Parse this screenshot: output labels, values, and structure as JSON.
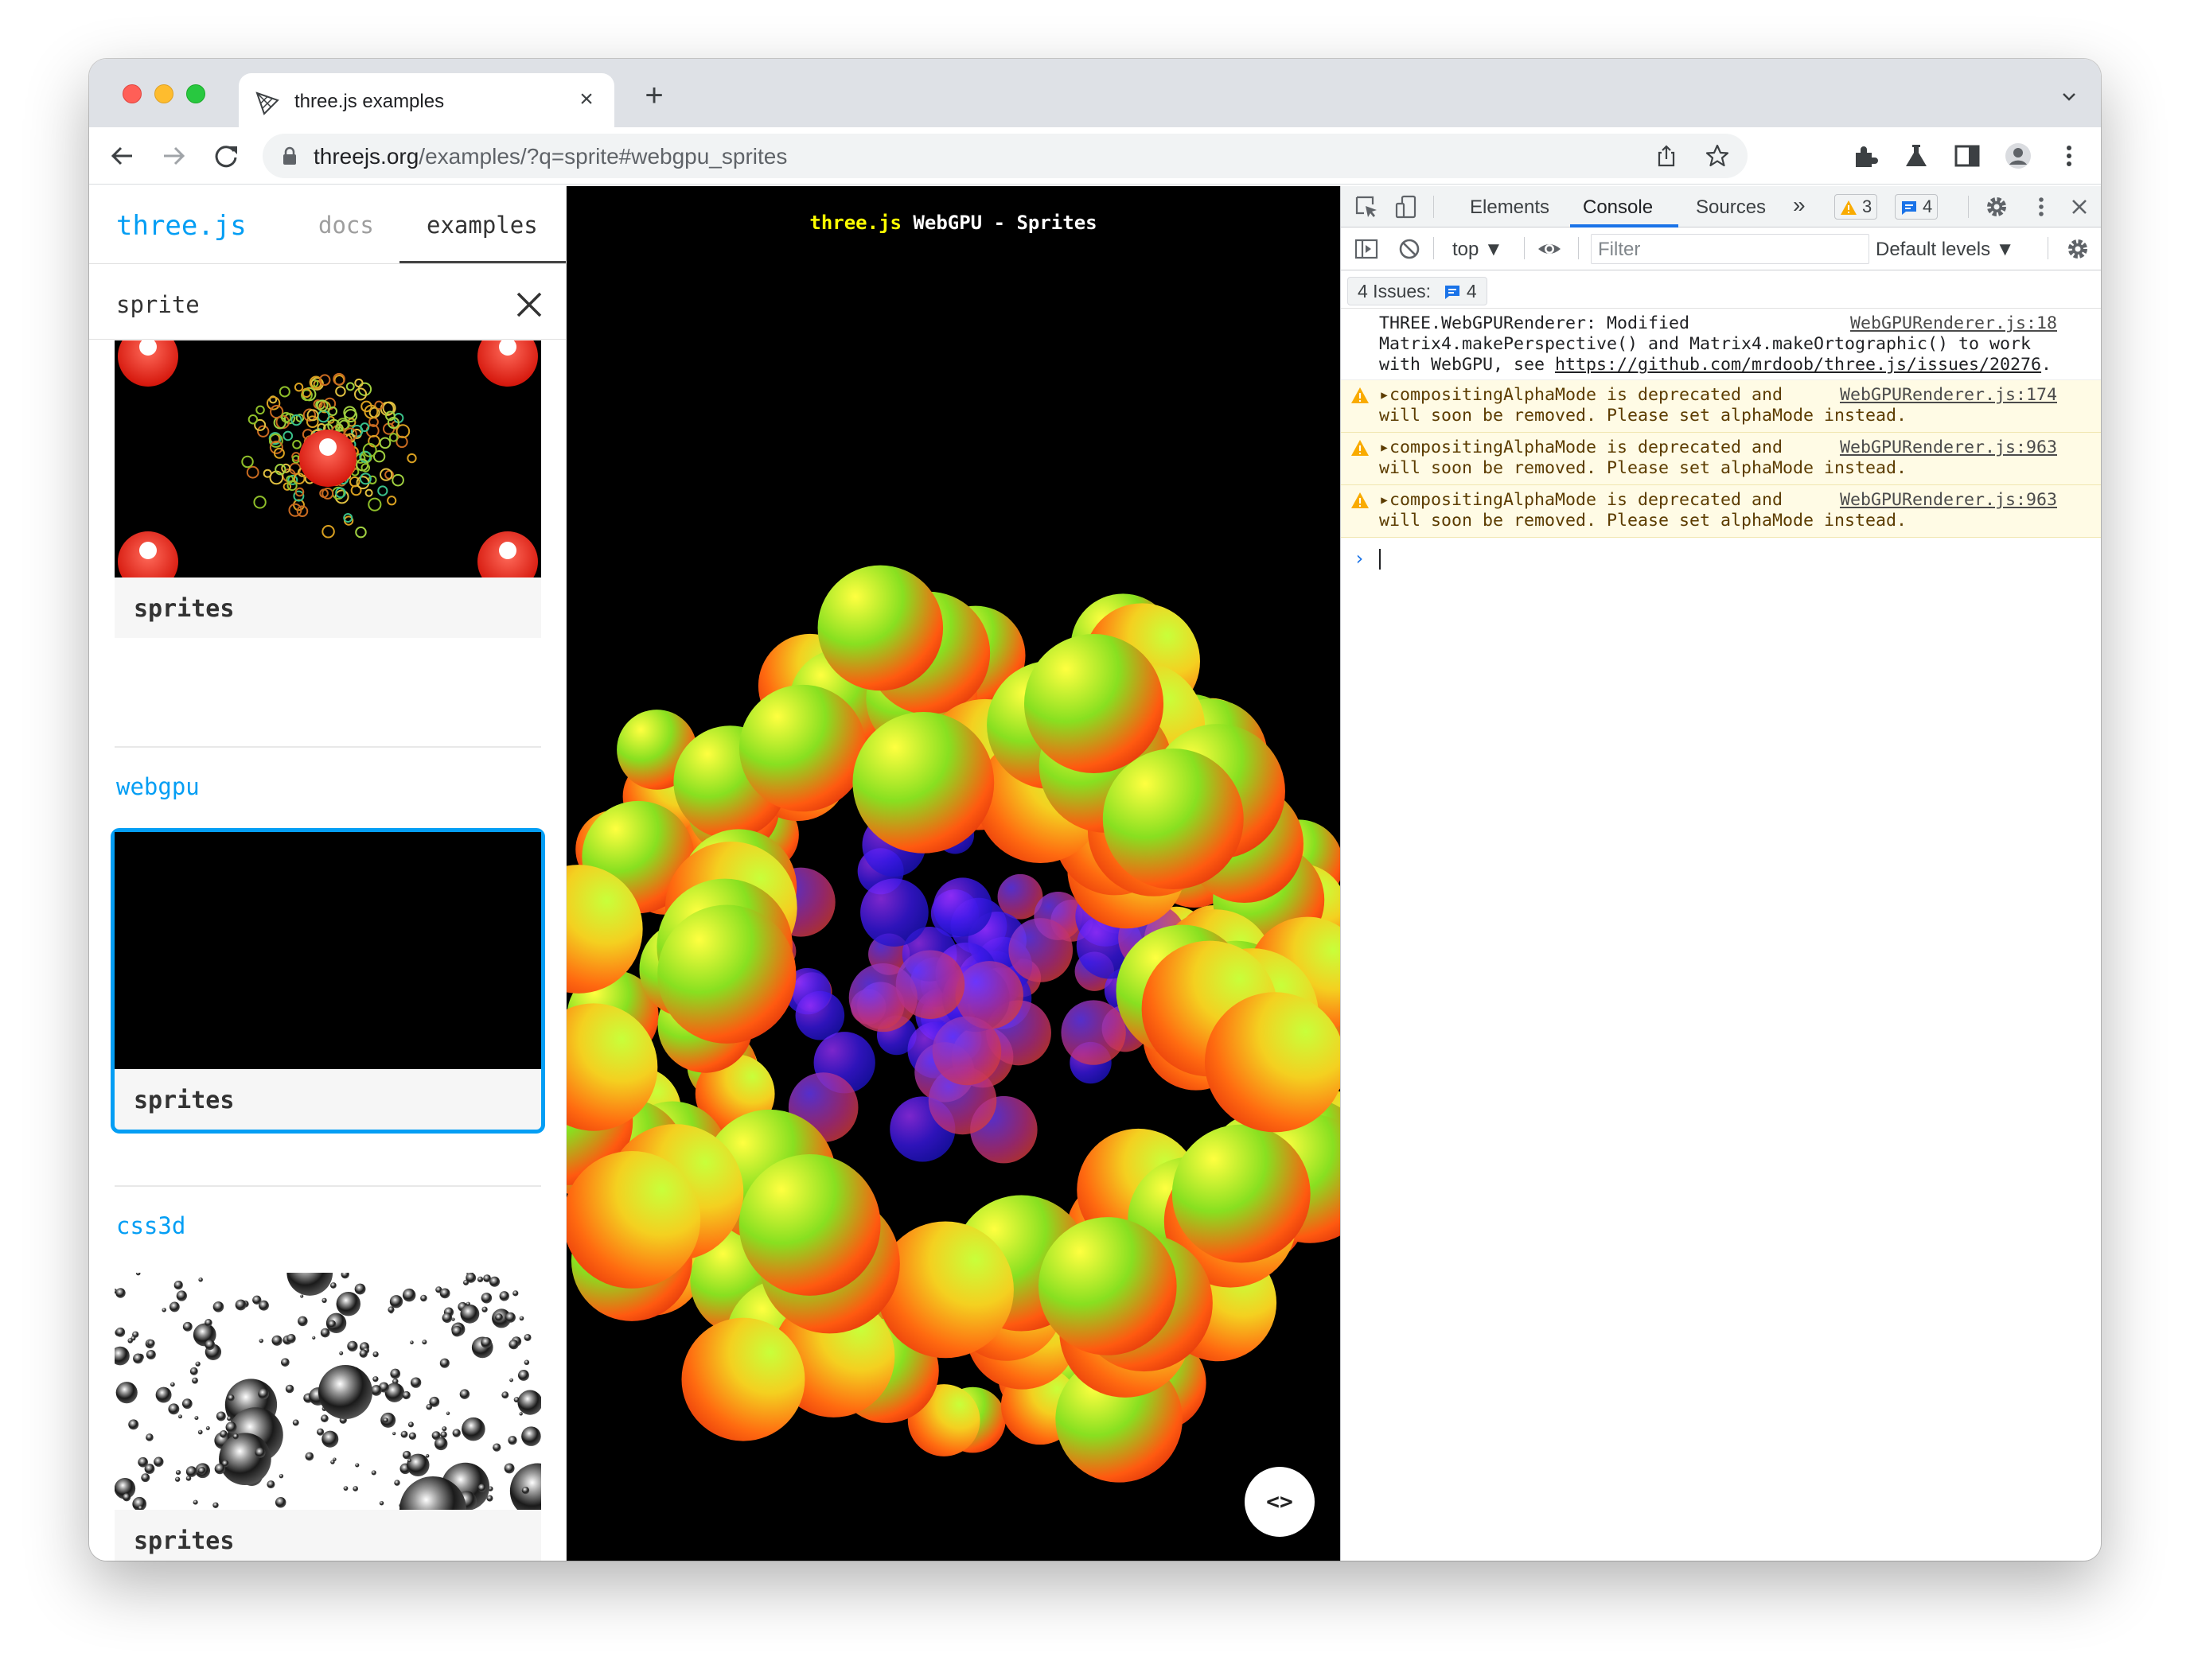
{
  "browser": {
    "tab_title": "three.js examples",
    "tab_close": "×",
    "new_tab": "+",
    "url_host": "threejs.org",
    "url_path": "/examples/?q=sprite#webgpu_sprites"
  },
  "sidebar": {
    "logo": "three.js",
    "nav": {
      "docs": "docs",
      "examples": "examples"
    },
    "search_value": "sprite",
    "sections": [
      {
        "title": "",
        "cards": [
          {
            "label": "sprites"
          }
        ]
      },
      {
        "title": "webgpu",
        "cards": [
          {
            "label": "sprites",
            "selected": true
          }
        ]
      },
      {
        "title": "css3d",
        "cards": [
          {
            "label": "sprites"
          }
        ]
      }
    ]
  },
  "viewport": {
    "info_brand": "three.js",
    "info_text": " WebGPU - Sprites",
    "view_source": "<>"
  },
  "devtools": {
    "tabs": [
      "Elements",
      "Console",
      "Sources"
    ],
    "active_tab": "Console",
    "more_tabs": "»",
    "warning_count": "3",
    "message_count": "4",
    "context": "top ▼",
    "filter_placeholder": "Filter",
    "levels": "Default levels ▼",
    "issues_label": "4 Issues:",
    "issues_count": "4",
    "messages": [
      {
        "type": "info",
        "line1": "THREE.WebGPURenderer: Modified",
        "line2": "Matrix4.makePerspective() and Matrix4.makeOrtographic() to work",
        "line3_prefix": "with WebGPU, see ",
        "link": "https://github.com/mrdoob/three.js/issues/20276",
        "line3_suffix": ".",
        "source": "WebGPURenderer.js:18"
      },
      {
        "type": "warn",
        "line1": "compositingAlphaMode is deprecated and",
        "line2": "will soon be removed. Please set alphaMode instead.",
        "source": "WebGPURenderer.js:174"
      },
      {
        "type": "warn",
        "line1": "compositingAlphaMode is deprecated and",
        "line2": "will soon be removed. Please set alphaMode instead.",
        "source": "WebGPURenderer.js:963"
      },
      {
        "type": "warn",
        "line1": "compositingAlphaMode is deprecated and",
        "line2": "will soon be removed. Please set alphaMode instead.",
        "source": "WebGPURenderer.js:963"
      }
    ],
    "prompt": "›"
  },
  "colors": {
    "accent": "#049ef4",
    "devtools_accent": "#1a73e8",
    "warning_bg": "#fffbe5",
    "warning_icon": "#f9ab00"
  }
}
